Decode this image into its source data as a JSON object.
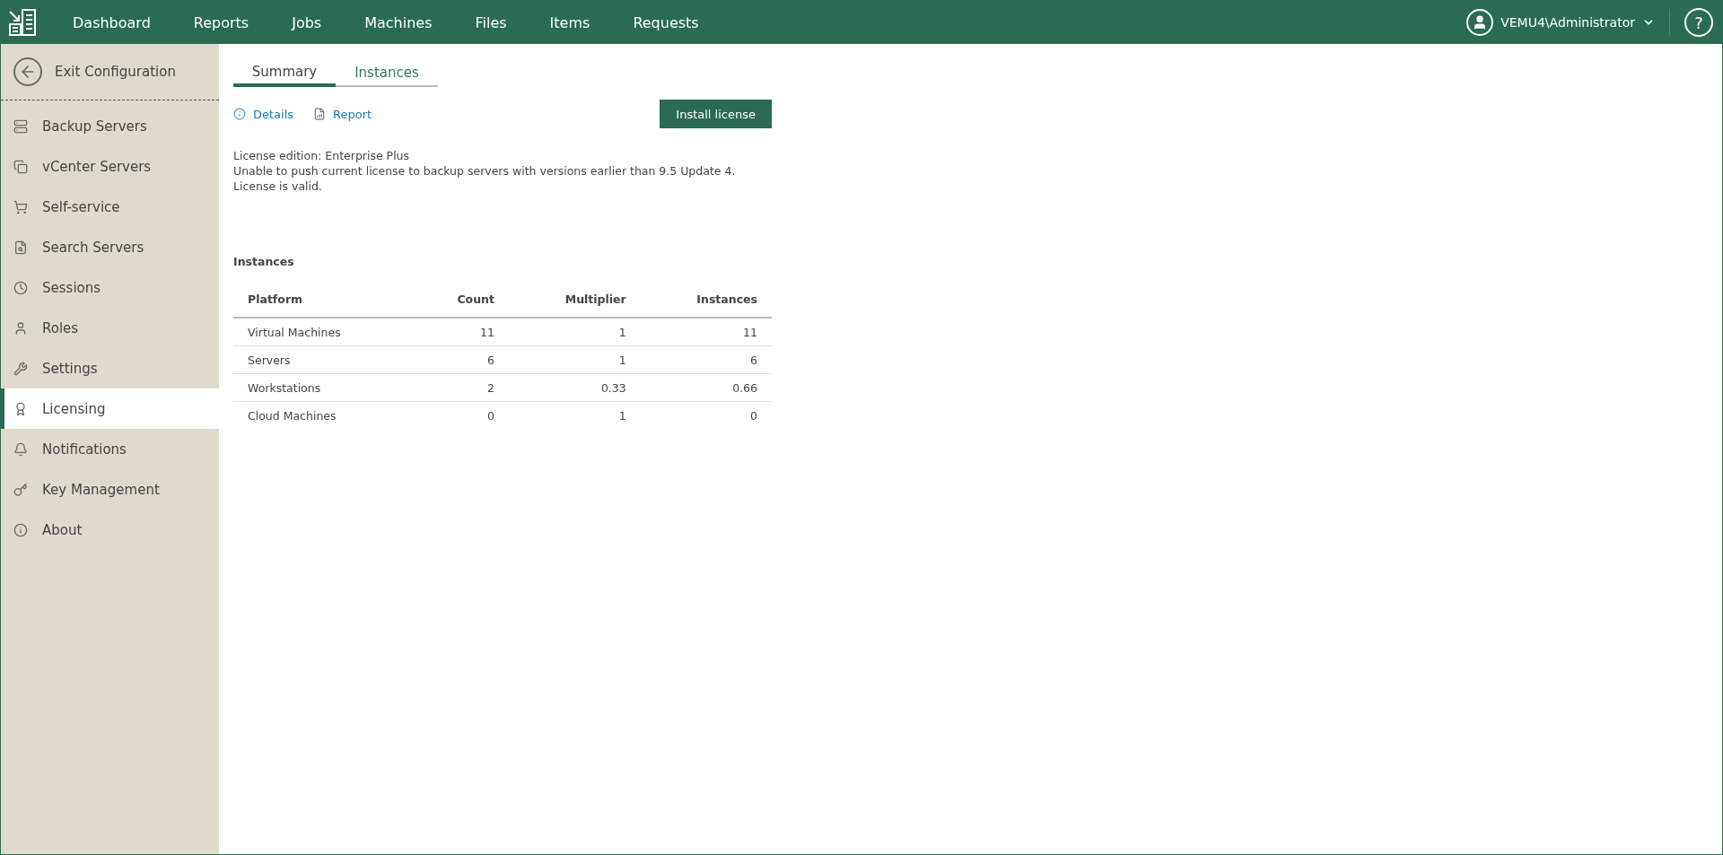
{
  "top_nav": {
    "items": [
      {
        "label": "Dashboard",
        "selected": false
      },
      {
        "label": "Reports",
        "selected": false
      },
      {
        "label": "Jobs",
        "selected": false
      },
      {
        "label": "Machines",
        "selected": false
      },
      {
        "label": "Files",
        "selected": false
      },
      {
        "label": "Items",
        "selected": false
      },
      {
        "label": "Requests",
        "selected": false
      }
    ],
    "user": "VEMU4\\Administrator",
    "help": "?"
  },
  "sidebar": {
    "exit": "Exit Configuration",
    "items": [
      {
        "label": "Backup Servers",
        "selected": false
      },
      {
        "label": "vCenter Servers",
        "selected": false
      },
      {
        "label": "Self-service",
        "selected": false
      },
      {
        "label": "Search Servers",
        "selected": false
      },
      {
        "label": "Sessions",
        "selected": false
      },
      {
        "label": "Roles",
        "selected": false
      },
      {
        "label": "Settings",
        "selected": false
      },
      {
        "label": "Licensing",
        "selected": true
      },
      {
        "label": "Notifications",
        "selected": false
      },
      {
        "label": "Key Management",
        "selected": false
      },
      {
        "label": "About",
        "selected": false
      }
    ]
  },
  "tabs": [
    {
      "label": "Summary",
      "selected": true
    },
    {
      "label": "Instances",
      "selected": false
    }
  ],
  "links": [
    "Details",
    "Report"
  ],
  "install_button": "Install license",
  "info_lines": [
    "License edition: Enterprise Plus",
    "Unable to push current license to backup servers with versions earlier than 9.5 Update 4.",
    "License is valid."
  ],
  "instances_title": "Instances",
  "table": {
    "columns": [
      "Platform",
      "Count",
      "Multiplier",
      "Instances"
    ],
    "rows": [
      [
        "Virtual Machines",
        "11",
        "1",
        "11"
      ],
      [
        "Servers",
        "6",
        "1",
        "6"
      ],
      [
        "Workstations",
        "2",
        "0.33",
        "0.66"
      ],
      [
        "Cloud Machines",
        "0",
        "1",
        "0"
      ]
    ]
  }
}
